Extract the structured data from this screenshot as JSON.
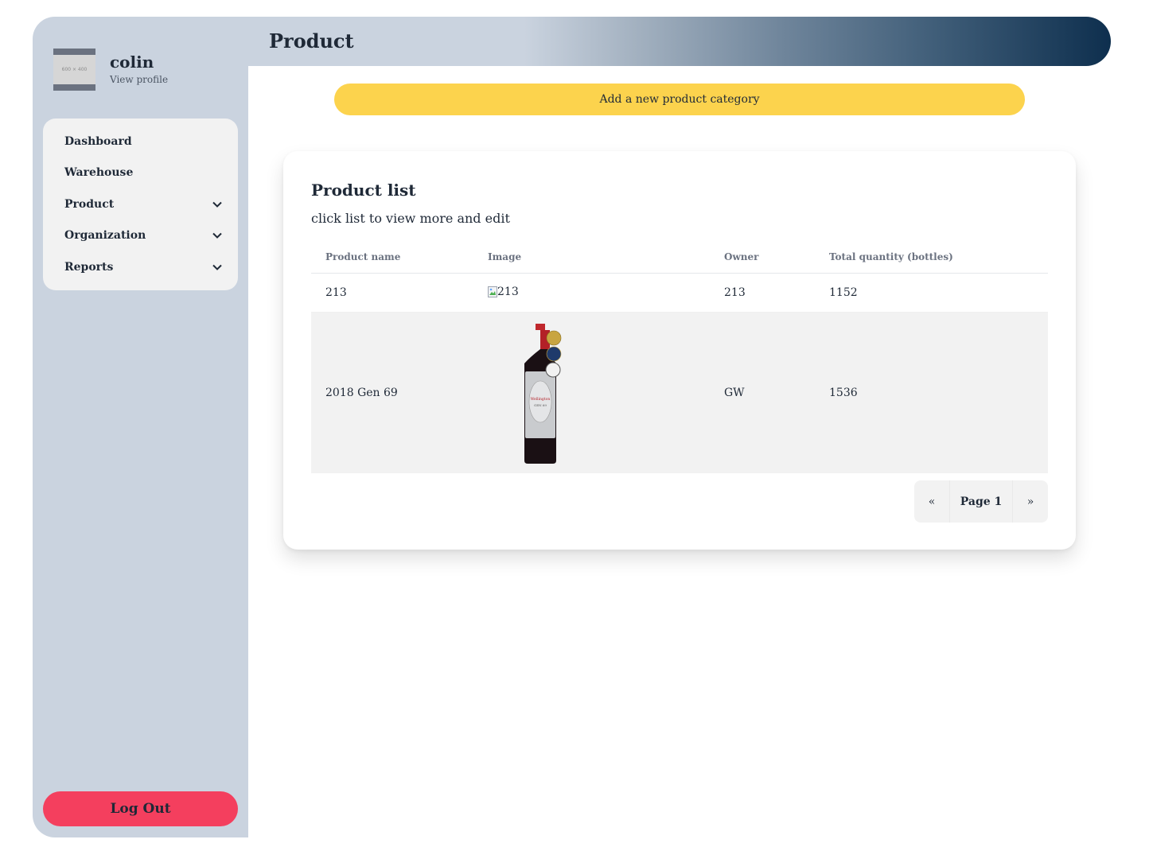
{
  "sidebar": {
    "avatar_placeholder": "600 × 400",
    "username": "colin",
    "view_profile": "View profile",
    "nav": [
      {
        "label": "Dashboard",
        "has_submenu": false
      },
      {
        "label": "Warehouse",
        "has_submenu": false
      },
      {
        "label": "Product",
        "has_submenu": true
      },
      {
        "label": "Organization",
        "has_submenu": true
      },
      {
        "label": "Reports",
        "has_submenu": true
      }
    ],
    "logout_label": "Log Out"
  },
  "header": {
    "title": "Product"
  },
  "actions": {
    "add_category_label": "Add a new product category"
  },
  "product_list": {
    "title": "Product list",
    "subtitle": "click list to view more and edit",
    "columns": [
      "Product name",
      "Image",
      "Owner",
      "Total quantity (bottles)"
    ],
    "rows": [
      {
        "name": "213",
        "image_alt": "213",
        "owner": "213",
        "quantity": "1152"
      },
      {
        "name": "2018 Gen 69",
        "image_alt": "",
        "owner": "GW",
        "quantity": "1536"
      }
    ]
  },
  "pagination": {
    "prev": "«",
    "current": "Page 1",
    "next": "»"
  },
  "colors": {
    "sidebar_bg": "#cad3df",
    "add_button": "#fcd34d",
    "logout_button": "#f43f5e",
    "header_gradient_end": "#0e2f4e"
  }
}
